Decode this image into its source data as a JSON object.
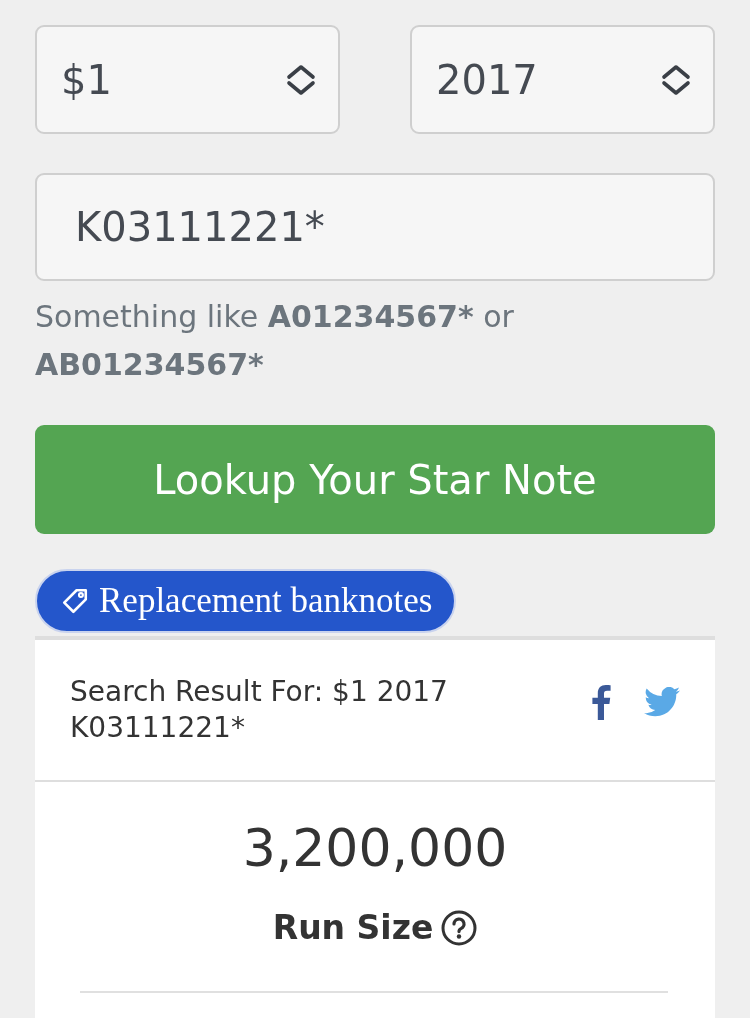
{
  "denomination_select": {
    "value": "$1"
  },
  "year_select": {
    "value": "2017"
  },
  "serial_field": {
    "value": "K03111221*"
  },
  "hint": [
    {
      "text": "Something like ",
      "bold": false
    },
    {
      "text": "A01234567*",
      "bold": true
    },
    {
      "text": " or ",
      "bold": false
    },
    {
      "text": "AB01234567*",
      "bold": true
    }
  ],
  "lookup_button": {
    "label": "Lookup Your Star Note"
  },
  "tag": {
    "label": "Replacement banknotes"
  },
  "result": {
    "title": "Search Result For: $1 2017 K03111221*",
    "stat": {
      "value": "3,200,000",
      "label": "Run Size"
    }
  }
}
